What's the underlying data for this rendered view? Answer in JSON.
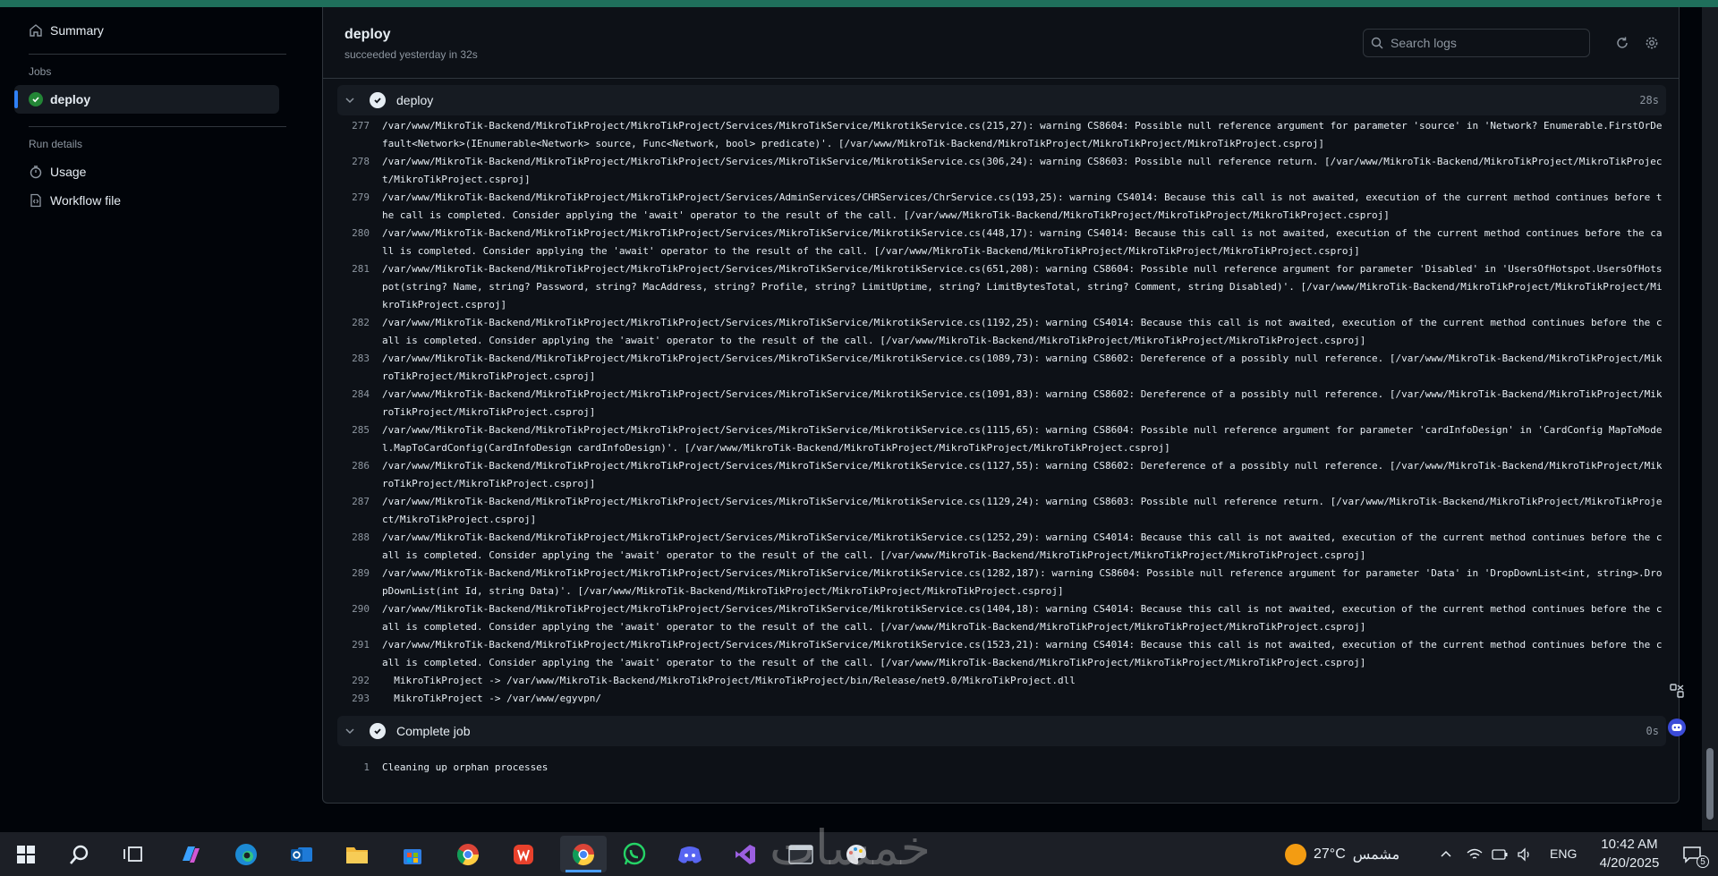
{
  "sidebar": {
    "summary_label": "Summary",
    "jobs_label": "Jobs",
    "job_name": "deploy",
    "run_details_label": "Run details",
    "usage_label": "Usage",
    "workflow_label": "Workflow file"
  },
  "header": {
    "title": "deploy",
    "subtitle": "succeeded yesterday in 32s",
    "search_placeholder": "Search logs"
  },
  "steps": [
    {
      "name": "deploy",
      "duration": "28s"
    },
    {
      "name": "Complete job",
      "duration": "0s"
    }
  ],
  "deploy_log": [
    {
      "n": "277",
      "t": "/var/www/MikroTik-Backend/MikroTikProject/MikroTikProject/Services/MikroTikService/MikrotikService.cs(215,27): warning CS8604: Possible null reference argument for parameter 'source' in 'Network? Enumerable.FirstOrDefault<Network>(IEnumerable<Network> source, Func<Network, bool> predicate)'. [/var/www/MikroTik-Backend/MikroTikProject/MikroTikProject/MikroTikProject.csproj]"
    },
    {
      "n": "278",
      "t": "/var/www/MikroTik-Backend/MikroTikProject/MikroTikProject/Services/MikroTikService/MikrotikService.cs(306,24): warning CS8603: Possible null reference return. [/var/www/MikroTik-Backend/MikroTikProject/MikroTikProject/MikroTikProject.csproj]"
    },
    {
      "n": "279",
      "t": "/var/www/MikroTik-Backend/MikroTikProject/MikroTikProject/Services/AdminServices/CHRServices/ChrService.cs(193,25): warning CS4014: Because this call is not awaited, execution of the current method continues before the call is completed. Consider applying the 'await' operator to the result of the call. [/var/www/MikroTik-Backend/MikroTikProject/MikroTikProject/MikroTikProject.csproj]"
    },
    {
      "n": "280",
      "t": "/var/www/MikroTik-Backend/MikroTikProject/MikroTikProject/Services/MikroTikService/MikrotikService.cs(448,17): warning CS4014: Because this call is not awaited, execution of the current method continues before the call is completed. Consider applying the 'await' operator to the result of the call. [/var/www/MikroTik-Backend/MikroTikProject/MikroTikProject/MikroTikProject.csproj]"
    },
    {
      "n": "281",
      "t": "/var/www/MikroTik-Backend/MikroTikProject/MikroTikProject/Services/MikroTikService/MikrotikService.cs(651,208): warning CS8604: Possible null reference argument for parameter 'Disabled' in 'UsersOfHotspot.UsersOfHotspot(string? Name, string? Password, string? MacAddress, string? Profile, string? LimitUptime, string? LimitBytesTotal, string? Comment, string Disabled)'. [/var/www/MikroTik-Backend/MikroTikProject/MikroTikProject/MikroTikProject.csproj]"
    },
    {
      "n": "282",
      "t": "/var/www/MikroTik-Backend/MikroTikProject/MikroTikProject/Services/MikroTikService/MikrotikService.cs(1192,25): warning CS4014: Because this call is not awaited, execution of the current method continues before the call is completed. Consider applying the 'await' operator to the result of the call. [/var/www/MikroTik-Backend/MikroTikProject/MikroTikProject/MikroTikProject.csproj]"
    },
    {
      "n": "283",
      "t": "/var/www/MikroTik-Backend/MikroTikProject/MikroTikProject/Services/MikroTikService/MikrotikService.cs(1089,73): warning CS8602: Dereference of a possibly null reference. [/var/www/MikroTik-Backend/MikroTikProject/MikroTikProject/MikroTikProject.csproj]"
    },
    {
      "n": "284",
      "t": "/var/www/MikroTik-Backend/MikroTikProject/MikroTikProject/Services/MikroTikService/MikrotikService.cs(1091,83): warning CS8602: Dereference of a possibly null reference. [/var/www/MikroTik-Backend/MikroTikProject/MikroTikProject/MikroTikProject.csproj]"
    },
    {
      "n": "285",
      "t": "/var/www/MikroTik-Backend/MikroTikProject/MikroTikProject/Services/MikroTikService/MikrotikService.cs(1115,65): warning CS8604: Possible null reference argument for parameter 'cardInfoDesign' in 'CardConfig MapToModel.MapToCardConfig(CardInfoDesign cardInfoDesign)'. [/var/www/MikroTik-Backend/MikroTikProject/MikroTikProject/MikroTikProject.csproj]"
    },
    {
      "n": "286",
      "t": "/var/www/MikroTik-Backend/MikroTikProject/MikroTikProject/Services/MikroTikService/MikrotikService.cs(1127,55): warning CS8602: Dereference of a possibly null reference. [/var/www/MikroTik-Backend/MikroTikProject/MikroTikProject/MikroTikProject.csproj]"
    },
    {
      "n": "287",
      "t": "/var/www/MikroTik-Backend/MikroTikProject/MikroTikProject/Services/MikroTikService/MikrotikService.cs(1129,24): warning CS8603: Possible null reference return. [/var/www/MikroTik-Backend/MikroTikProject/MikroTikProject/MikroTikProject.csproj]"
    },
    {
      "n": "288",
      "t": "/var/www/MikroTik-Backend/MikroTikProject/MikroTikProject/Services/MikroTikService/MikrotikService.cs(1252,29): warning CS4014: Because this call is not awaited, execution of the current method continues before the call is completed. Consider applying the 'await' operator to the result of the call. [/var/www/MikroTik-Backend/MikroTikProject/MikroTikProject/MikroTikProject.csproj]"
    },
    {
      "n": "289",
      "t": "/var/www/MikroTik-Backend/MikroTikProject/MikroTikProject/Services/MikroTikService/MikrotikService.cs(1282,187): warning CS8604: Possible null reference argument for parameter 'Data' in 'DropDownList<int, string>.DropDownList(int Id, string Data)'. [/var/www/MikroTik-Backend/MikroTikProject/MikroTikProject/MikroTikProject.csproj]"
    },
    {
      "n": "290",
      "t": "/var/www/MikroTik-Backend/MikroTikProject/MikroTikProject/Services/MikroTikService/MikrotikService.cs(1404,18): warning CS4014: Because this call is not awaited, execution of the current method continues before the call is completed. Consider applying the 'await' operator to the result of the call. [/var/www/MikroTik-Backend/MikroTikProject/MikroTikProject/MikroTikProject.csproj]"
    },
    {
      "n": "291",
      "t": "/var/www/MikroTik-Backend/MikroTikProject/MikroTikProject/Services/MikroTikService/MikrotikService.cs(1523,21): warning CS4014: Because this call is not awaited, execution of the current method continues before the call is completed. Consider applying the 'await' operator to the result of the call. [/var/www/MikroTik-Backend/MikroTikProject/MikroTikProject/MikroTikProject.csproj]"
    },
    {
      "n": "292",
      "t": "  MikroTikProject -> /var/www/MikroTik-Backend/MikroTikProject/MikroTikProject/bin/Release/net9.0/MikroTikProject.dll"
    },
    {
      "n": "293",
      "t": "  MikroTikProject -> /var/www/egyvpn/"
    }
  ],
  "complete_log": [
    {
      "n": "1",
      "t": "Cleaning up orphan processes"
    }
  ],
  "taskbar": {
    "weather_temp": "27°C",
    "weather_label": "مشمس",
    "language": "ENG",
    "time": "10:42 AM",
    "date": "4/20/2025",
    "notif_count": "5",
    "watermark": "خمسات"
  },
  "colors": {
    "success": "#238636",
    "accent": "#2f81f7"
  }
}
